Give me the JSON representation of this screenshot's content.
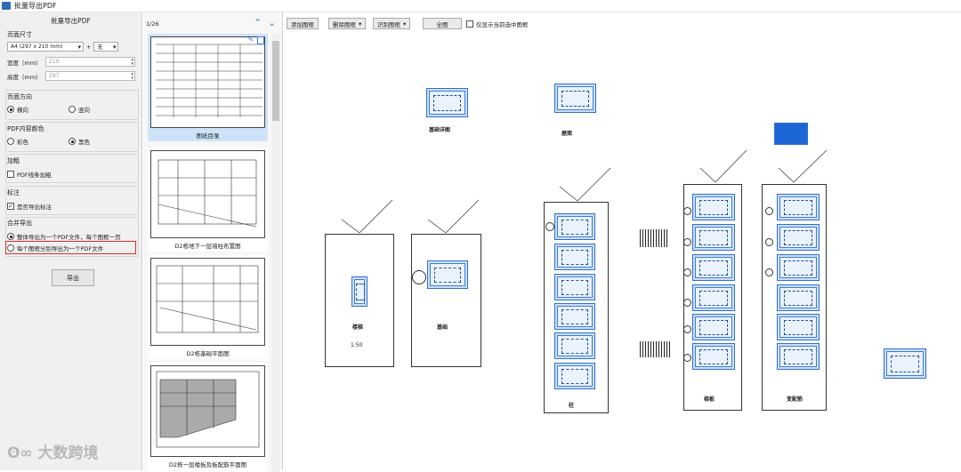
{
  "window": {
    "title": "批量导出PDF"
  },
  "left": {
    "header": "批量导出PDF",
    "page_size_label": "页面尺寸",
    "paper": "A4 (297 x 210 mm)",
    "plus": "+",
    "extra": "无",
    "width_label": "宽度（mm）",
    "width_value": "210",
    "height_label": "高度（mm）",
    "height_value": "297",
    "orientation_label": "页面方向",
    "landscape": "横向",
    "portrait": "竖向",
    "color_label": "PDF内容颜色",
    "color": "彩色",
    "black": "黑色",
    "bold_label": "加粗",
    "bold_option": "PDF线条加粗",
    "annot_label": "标注",
    "annot_option": "是否导出标注",
    "merge_label": "合并导出",
    "merge_single": "整体导出为一个PDF文件，每个图框一页",
    "merge_each": "每个图框分别导出为一个PDF文件",
    "export": "导出"
  },
  "mid": {
    "counter": "1/26",
    "thumbs": [
      "图纸目录",
      "D2栋地下一层墙柱布置图",
      "D2栋基础平面图",
      "D2栋一层楼板及板配筋平面图"
    ]
  },
  "toolbar": {
    "add": "添加图框",
    "delete": "删除图框",
    "detect": "识别图框",
    "full": "全图",
    "only_sel": "仅显示当前选中图框"
  },
  "canvas": {
    "labels": [
      "基础详图",
      "屋面",
      "楼梯",
      "基础",
      "柱",
      "梯板",
      "变配筋"
    ],
    "scale": "1:50"
  },
  "watermark": "大数跨境",
  "colors": {
    "accent": "#2d6fd3",
    "highlight": "#e02a2a",
    "selected": "#cfe3f8"
  }
}
